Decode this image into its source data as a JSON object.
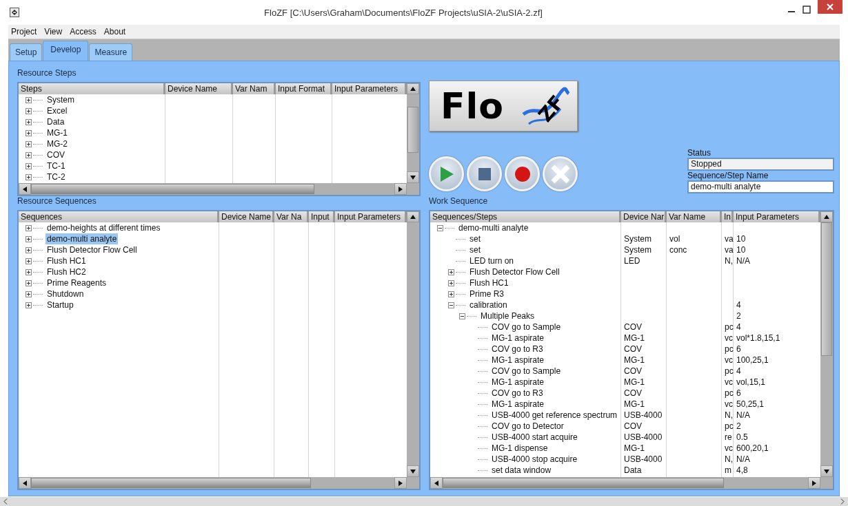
{
  "window": {
    "title": "FloZF [C:\\Users\\Graham\\Documents\\FloZF Projects\\uSIA-2\\uSIA-2.zf]"
  },
  "menu": [
    "Project",
    "View",
    "Access",
    "About"
  ],
  "tabs": [
    {
      "label": "Setup",
      "selected": false
    },
    {
      "label": "Develop",
      "selected": true
    },
    {
      "label": "Measure",
      "selected": false
    }
  ],
  "resource_steps": {
    "title": "Resource Steps",
    "columns": [
      "Steps",
      "Device Name",
      "Var Nam",
      "Input Format",
      "Input Parameters"
    ],
    "items": [
      {
        "label": "System",
        "expanded": false
      },
      {
        "label": "Excel",
        "expanded": false
      },
      {
        "label": "Data",
        "expanded": false
      },
      {
        "label": "MG-1",
        "expanded": false
      },
      {
        "label": "MG-2",
        "expanded": false
      },
      {
        "label": "COV",
        "expanded": false
      },
      {
        "label": "TC-1",
        "expanded": false
      },
      {
        "label": "TC-2",
        "expanded": false
      }
    ]
  },
  "logo": {
    "text": "Flo",
    "mark": "ZF"
  },
  "controls": [
    {
      "kind": "play"
    },
    {
      "kind": "stop"
    },
    {
      "kind": "record"
    },
    {
      "kind": "cancel"
    }
  ],
  "status": {
    "label": "Status",
    "value": "Stopped"
  },
  "step_name": {
    "label": "Sequence/Step Name",
    "value": "demo-multi analyte"
  },
  "resource_sequences": {
    "title": "Resource Sequences",
    "columns": [
      "Sequences",
      "Device Name",
      "Var Na",
      "Input",
      "Input Parameters"
    ],
    "items": [
      {
        "label": "demo-heights at different times",
        "expanded": false,
        "selected": false
      },
      {
        "label": "demo-multi analyte",
        "expanded": false,
        "selected": true
      },
      {
        "label": "Flush Detector Flow Cell",
        "expanded": false,
        "selected": false
      },
      {
        "label": "Flush HC1",
        "expanded": false,
        "selected": false
      },
      {
        "label": "Flush HC2",
        "expanded": false,
        "selected": false
      },
      {
        "label": "Prime Reagents",
        "expanded": false,
        "selected": false
      },
      {
        "label": "Shutdown",
        "expanded": false,
        "selected": false
      },
      {
        "label": "Startup",
        "expanded": false,
        "selected": false
      }
    ]
  },
  "work_sequence": {
    "title": "Work Sequence",
    "columns": [
      "Sequences/Steps",
      "Device Nar",
      "Var Name",
      "In",
      "Input Parameters"
    ],
    "items": [
      {
        "label": "demo-multi analyte",
        "expanded": true,
        "children": [
          {
            "label": "set",
            "device": "System",
            "var": "vol",
            "format": "va",
            "params": "10"
          },
          {
            "label": "set",
            "device": "System",
            "var": "conc",
            "format": "va",
            "params": "10"
          },
          {
            "label": "LED turn on",
            "device": "LED",
            "format": "N,",
            "params": "N/A"
          },
          {
            "label": "Flush Detector Flow Cell",
            "expanded": false
          },
          {
            "label": "Flush HC1",
            "expanded": false
          },
          {
            "label": "Prime R3",
            "expanded": false
          },
          {
            "label": "calibration",
            "expanded": true,
            "params": "4",
            "children": [
              {
                "label": "Multiple Peaks",
                "expanded": true,
                "params": "2",
                "children": [
                  {
                    "label": "COV go to Sample",
                    "device": "COV",
                    "format": "pc",
                    "params": "4"
                  },
                  {
                    "label": "MG-1 aspirate",
                    "device": "MG-1",
                    "format": "vc",
                    "params": "vol*1.8,15,1"
                  },
                  {
                    "label": "COV go to R3",
                    "device": "COV",
                    "format": "pc",
                    "params": "6"
                  },
                  {
                    "label": "MG-1 aspirate",
                    "device": "MG-1",
                    "format": "vc",
                    "params": "100,25,1"
                  },
                  {
                    "label": "COV go to Sample",
                    "device": "COV",
                    "format": "pc",
                    "params": "4"
                  },
                  {
                    "label": "MG-1 aspirate",
                    "device": "MG-1",
                    "format": "vc",
                    "params": "vol,15,1"
                  },
                  {
                    "label": "COV go to R3",
                    "device": "COV",
                    "format": "pc",
                    "params": "6"
                  },
                  {
                    "label": "MG-1 aspirate",
                    "device": "MG-1",
                    "format": "vc",
                    "params": "50,25,1"
                  },
                  {
                    "label": "USB-4000 get reference spectrum",
                    "device": "USB-4000",
                    "format": "N,",
                    "params": "N/A"
                  },
                  {
                    "label": "COV go to Detector",
                    "device": "COV",
                    "format": "pc",
                    "params": "2"
                  },
                  {
                    "label": "USB-4000 start acquire",
                    "device": "USB-4000",
                    "format": "re",
                    "params": "0.5"
                  },
                  {
                    "label": "MG-1 dispense",
                    "device": "MG-1",
                    "format": "vc",
                    "params": "600,20,1"
                  },
                  {
                    "label": "USB-4000 stop acquire",
                    "device": "USB-4000",
                    "format": "N,",
                    "params": "N/A"
                  },
                  {
                    "label": "set data window",
                    "device": "Data",
                    "format": "m",
                    "params": "4,8"
                  }
                ]
              }
            ]
          }
        ]
      }
    ]
  }
}
